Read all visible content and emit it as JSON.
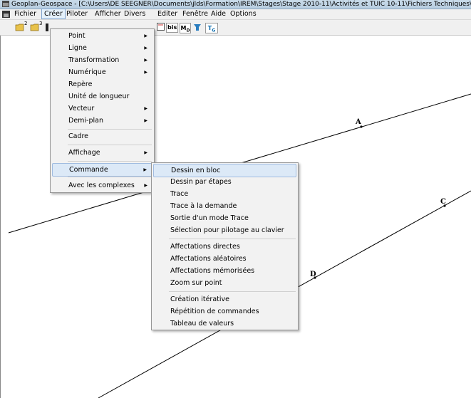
{
  "window": {
    "title": "Geoplan-Geospace - [C:\\Users\\DE SEEGNER\\Documents\\jlds\\Formation\\IREM\\Stages\\Stage 2010-11\\Activités et TUIC 10-11\\Fichiers Techniques\\Geoplan_"
  },
  "menubar": {
    "items": [
      "Fichier",
      "Créer",
      "Piloter",
      "Afficher",
      "Divers",
      "Editer",
      "Fenêtre",
      "Aide",
      "Options"
    ],
    "active": "Créer"
  },
  "toolbar": {
    "superscripts": [
      "2",
      "3"
    ],
    "buttons": [
      "bis",
      "M",
      "T"
    ],
    "sub_d": "D",
    "sub_g": "G"
  },
  "menu_creer": {
    "items": [
      "Point",
      "Ligne",
      "Transformation",
      "Numérique",
      "Repère",
      "Unité de longueur",
      "Vecteur",
      "Demi-plan",
      "Cadre",
      "Affichage",
      "Commande",
      "Avec les complexes"
    ],
    "submenu_flags": [
      true,
      true,
      true,
      true,
      false,
      false,
      true,
      true,
      false,
      true,
      true,
      true
    ],
    "highlighted": "Commande"
  },
  "submenu_commande": {
    "group1": [
      "Dessin en bloc",
      "Dessin par étapes",
      "Trace",
      "Trace à la demande",
      "Sortie d'un mode Trace",
      "Sélection pour pilotage au clavier"
    ],
    "group2": [
      "Affectations directes",
      "Affectations aléatoires",
      "Affectations mémorisées",
      "Zoom sur point"
    ],
    "group3": [
      "Création itérative",
      "Répétition de commandes",
      "Tableau de valeurs"
    ],
    "highlighted": "Dessin en bloc"
  },
  "points": {
    "A": "A",
    "C": "C",
    "D": "D"
  },
  "colors": {
    "menu_bg": "#f2f2f2",
    "highlight": "#dce9f7",
    "highlight_border": "#9fbbe0"
  }
}
